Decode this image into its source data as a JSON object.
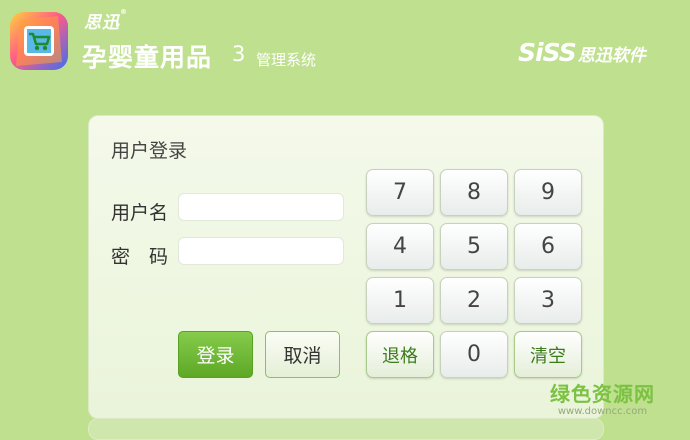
{
  "header": {
    "brand_small": "思迅",
    "brand_mark": "®",
    "product_name": "孕婴童用品",
    "version": "3",
    "product_sub": "管理系统",
    "company_en": "SiSS",
    "company_cn": "思迅软件",
    "logo_icon": "shopping-cart-icon"
  },
  "login": {
    "title": "用户登录",
    "username_label": "用户名",
    "password_label": "密　码",
    "username_value": "",
    "password_value": "",
    "login_button": "登录",
    "cancel_button": "取消"
  },
  "keypad": {
    "keys": [
      "7",
      "8",
      "9",
      "4",
      "5",
      "6",
      "1",
      "2",
      "3"
    ],
    "backspace": "退格",
    "zero": "0",
    "clear": "清空"
  },
  "watermark": {
    "site_name": "绿色资源网",
    "url": "www.downcc.com"
  },
  "colors": {
    "background": "#bfe08f",
    "accent": "#6ab52f"
  }
}
